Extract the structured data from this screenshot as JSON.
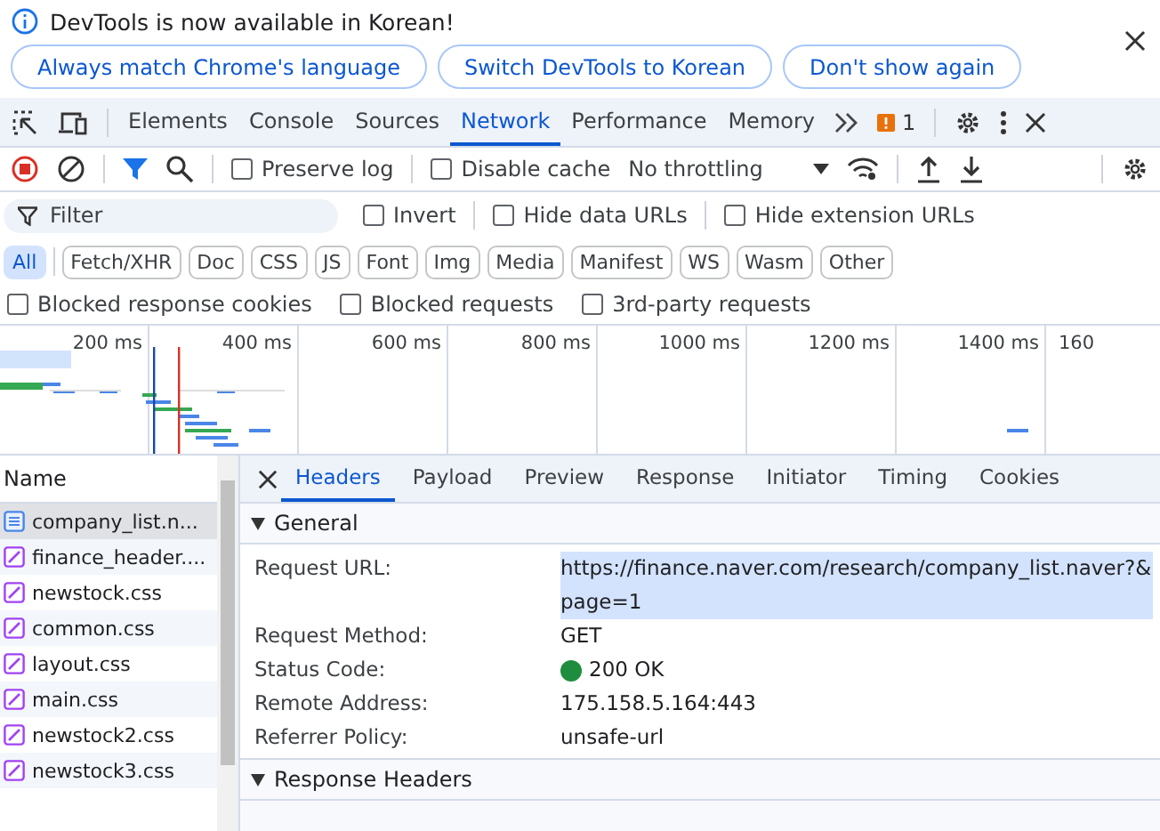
{
  "infobar": {
    "message": "DevTools is now available in Korean!",
    "buttons": [
      "Always match Chrome's language",
      "Switch DevTools to Korean",
      "Don't show again"
    ]
  },
  "panel_tabs": [
    {
      "label": "Elements",
      "selected": false
    },
    {
      "label": "Console",
      "selected": false
    },
    {
      "label": "Sources",
      "selected": false
    },
    {
      "label": "Network",
      "selected": true
    },
    {
      "label": "Performance",
      "selected": false
    },
    {
      "label": "Memory",
      "selected": false
    }
  ],
  "issues_count": "1",
  "toolbar": {
    "preserve_log": {
      "label": "Preserve log",
      "checked": false
    },
    "disable_cache": {
      "label": "Disable cache",
      "checked": false
    },
    "throttling": "No throttling"
  },
  "filter": {
    "placeholder": "Filter",
    "options": [
      {
        "label": "Invert",
        "checked": false
      },
      {
        "label": "Hide data URLs",
        "checked": false
      },
      {
        "label": "Hide extension URLs",
        "checked": false
      }
    ]
  },
  "type_filters": [
    {
      "label": "All",
      "selected": true
    },
    {
      "label": "Fetch/XHR",
      "selected": false
    },
    {
      "label": "Doc",
      "selected": false
    },
    {
      "label": "CSS",
      "selected": false
    },
    {
      "label": "JS",
      "selected": false
    },
    {
      "label": "Font",
      "selected": false
    },
    {
      "label": "Img",
      "selected": false
    },
    {
      "label": "Media",
      "selected": false
    },
    {
      "label": "Manifest",
      "selected": false
    },
    {
      "label": "WS",
      "selected": false
    },
    {
      "label": "Wasm",
      "selected": false
    },
    {
      "label": "Other",
      "selected": false
    }
  ],
  "blocked_options": [
    {
      "label": "Blocked response cookies",
      "checked": false
    },
    {
      "label": "Blocked requests",
      "checked": false
    },
    {
      "label": "3rd-party requests",
      "checked": false
    }
  ],
  "overview_ticks": [
    "200 ms",
    "400 ms",
    "600 ms",
    "800 ms",
    "1000 ms",
    "1200 ms",
    "1400 ms",
    "160"
  ],
  "requests": {
    "column": "Name",
    "rows": [
      {
        "name": "company_list.n...",
        "kind": "document",
        "selected": true
      },
      {
        "name": "finance_header....",
        "kind": "stylesheet",
        "selected": false
      },
      {
        "name": "newstock.css",
        "kind": "stylesheet",
        "selected": false
      },
      {
        "name": "common.css",
        "kind": "stylesheet",
        "selected": false
      },
      {
        "name": "layout.css",
        "kind": "stylesheet",
        "selected": false
      },
      {
        "name": "main.css",
        "kind": "stylesheet",
        "selected": false
      },
      {
        "name": "newstock2.css",
        "kind": "stylesheet",
        "selected": false
      },
      {
        "name": "newstock3.css",
        "kind": "stylesheet",
        "selected": false
      }
    ]
  },
  "detail_tabs": [
    {
      "label": "Headers",
      "selected": true
    },
    {
      "label": "Payload",
      "selected": false
    },
    {
      "label": "Preview",
      "selected": false
    },
    {
      "label": "Response",
      "selected": false
    },
    {
      "label": "Initiator",
      "selected": false
    },
    {
      "label": "Timing",
      "selected": false
    },
    {
      "label": "Cookies",
      "selected": false
    }
  ],
  "sections": [
    {
      "title": "General",
      "expanded": true,
      "rows": [
        {
          "key": "Request URL:",
          "value": "https://finance.naver.com/research/company_list.naver?&page=1",
          "kind": "url"
        },
        {
          "key": "Request Method:",
          "value": "GET",
          "kind": "text"
        },
        {
          "key": "Status Code:",
          "value": "200 OK",
          "kind": "status"
        },
        {
          "key": "Remote Address:",
          "value": "175.158.5.164:443",
          "kind": "text"
        },
        {
          "key": "Referrer Policy:",
          "value": "unsafe-url",
          "kind": "text"
        }
      ]
    },
    {
      "title": "Response Headers",
      "expanded": true
    }
  ]
}
